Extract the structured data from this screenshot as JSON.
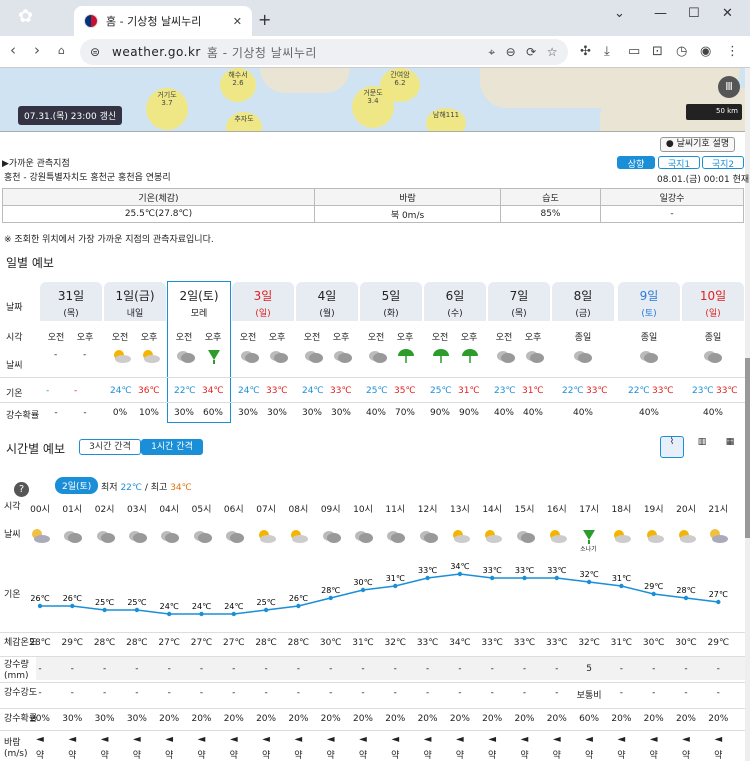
{
  "browser": {
    "tab_title": "홈 - 기상청 날씨누리",
    "url_domain": "weather.go.kr",
    "url_rest": "홈 - 기상청 날씨누리"
  },
  "map": {
    "updated": "07.31.(목) 23:00 갱신",
    "scale": "50 km",
    "stations": [
      "해수서",
      "간여암",
      "거기도",
      "거문도",
      "추자도",
      "남해111"
    ],
    "station_vals": [
      "2.6",
      "6.2",
      "3.7",
      "3.4",
      "",
      "1.2"
    ]
  },
  "legend_btn": "날씨기호 설명",
  "obs": {
    "title": "▶가까운 관측지점",
    "location": "홍천 - 강원특별자치도 홍천군 홍천읍 연봉리",
    "tabs": [
      "상향",
      "국지1",
      "국지2"
    ],
    "time": "08.01.(금) 00:01 현재",
    "headers": [
      "기온(체감)",
      "바람",
      "습도",
      "일강수"
    ],
    "values": [
      "25.5℃(27.8℃)",
      "북 0m/s",
      "85%",
      "-"
    ],
    "note": "※ 조회한 위치에서 가장 가까운 지점의 관측자료입니다."
  },
  "daily": {
    "title": "일별 예보",
    "row_labels": [
      "날짜",
      "시각",
      "날씨",
      "기온",
      "강수확률"
    ],
    "days": [
      {
        "date": "31일",
        "sub": "(목)",
        "ampm": [
          "오전",
          "오후"
        ],
        "min": "-",
        "max": "-",
        "pop": [
          "-",
          "-"
        ]
      },
      {
        "date": "1일(금)",
        "sub": "내일",
        "ampm": [
          "오전",
          "오후"
        ],
        "min": "24℃",
        "max": "36℃",
        "pop": [
          "0%",
          "10%"
        ]
      },
      {
        "date": "2일(토)",
        "sub": "모레",
        "ampm": [
          "오전",
          "오후"
        ],
        "min": "22℃",
        "max": "34℃",
        "pop": [
          "30%",
          "60%"
        ]
      },
      {
        "date": "3일",
        "sub": "(일)",
        "ampm": [
          "오전",
          "오후"
        ],
        "min": "24℃",
        "max": "33℃",
        "pop": [
          "30%",
          "30%"
        ]
      },
      {
        "date": "4일",
        "sub": "(월)",
        "ampm": [
          "오전",
          "오후"
        ],
        "min": "24℃",
        "max": "33℃",
        "pop": [
          "30%",
          "30%"
        ]
      },
      {
        "date": "5일",
        "sub": "(화)",
        "ampm": [
          "오전",
          "오후"
        ],
        "min": "25℃",
        "max": "35℃",
        "pop": [
          "40%",
          "70%"
        ]
      },
      {
        "date": "6일",
        "sub": "(수)",
        "ampm": [
          "오전",
          "오후"
        ],
        "min": "25℃",
        "max": "31℃",
        "pop": [
          "90%",
          "90%"
        ]
      },
      {
        "date": "7일",
        "sub": "(목)",
        "ampm": [
          "오전",
          "오후"
        ],
        "min": "23℃",
        "max": "31℃",
        "pop": [
          "40%",
          "40%"
        ]
      },
      {
        "date": "8일",
        "sub": "(금)",
        "ampm": [
          "종일"
        ],
        "min": "22℃",
        "max": "33℃",
        "pop": [
          "40%"
        ]
      },
      {
        "date": "9일",
        "sub": "(토)",
        "ampm": [
          "종일"
        ],
        "min": "22℃",
        "max": "33℃",
        "pop": [
          "40%"
        ]
      },
      {
        "date": "10일",
        "sub": "(일)",
        "ampm": [
          "종일"
        ],
        "min": "23℃",
        "max": "33℃",
        "pop": [
          "40%"
        ]
      }
    ]
  },
  "hourly": {
    "title": "시간별 예보",
    "tabs": [
      "3시간 간격",
      "1시간 간격"
    ],
    "day_badge": "2일(토)",
    "minmax_label": "최저",
    "min": "22℃",
    "max_label": "최고",
    "max": "34℃",
    "row_labels": [
      "시각",
      "날씨",
      "기온",
      "체감온도",
      "강수량\n(mm)",
      "강수강도",
      "강수확률",
      "바람\n(m/s)"
    ],
    "hours": [
      "00시",
      "01시",
      "02시",
      "03시",
      "04시",
      "05시",
      "06시",
      "07시",
      "08시",
      "09시",
      "10시",
      "11시",
      "12시",
      "13시",
      "14시",
      "15시",
      "16시",
      "17시",
      "18시",
      "19시",
      "20시",
      "21시"
    ],
    "temps": [
      26,
      26,
      25,
      25,
      24,
      24,
      24,
      25,
      26,
      28,
      30,
      31,
      33,
      34,
      33,
      33,
      33,
      32,
      31,
      29,
      28,
      27
    ],
    "feels": [
      "28℃",
      "29℃",
      "28℃",
      "28℃",
      "27℃",
      "27℃",
      "27℃",
      "28℃",
      "28℃",
      "30℃",
      "31℃",
      "32℃",
      "33℃",
      "34℃",
      "33℃",
      "33℃",
      "33℃",
      "32℃",
      "31℃",
      "30℃",
      "30℃",
      "29℃"
    ],
    "rain": [
      "-",
      "-",
      "-",
      "-",
      "-",
      "-",
      "-",
      "-",
      "-",
      "-",
      "-",
      "-",
      "-",
      "-",
      "-",
      "-",
      "-",
      "5",
      "-",
      "-",
      "-",
      "-"
    ],
    "intensity": [
      "-",
      "-",
      "-",
      "-",
      "-",
      "-",
      "-",
      "-",
      "-",
      "-",
      "-",
      "-",
      "-",
      "-",
      "-",
      "-",
      "-",
      "보통비",
      "-",
      "-",
      "-",
      "-"
    ],
    "pop": [
      "20%",
      "30%",
      "30%",
      "30%",
      "20%",
      "20%",
      "20%",
      "20%",
      "20%",
      "20%",
      "20%",
      "20%",
      "20%",
      "20%",
      "20%",
      "20%",
      "20%",
      "60%",
      "20%",
      "20%",
      "20%",
      "20%"
    ],
    "wind": [
      "약",
      "약",
      "약",
      "약",
      "약",
      "약",
      "약",
      "약",
      "약",
      "약",
      "약",
      "약",
      "약",
      "약",
      "약",
      "약",
      "약",
      "약",
      "약",
      "약",
      "약",
      "약"
    ],
    "shower_label": "소나기"
  },
  "colors": {
    "accent": "#1a8fd8",
    "max": "#e02020"
  }
}
